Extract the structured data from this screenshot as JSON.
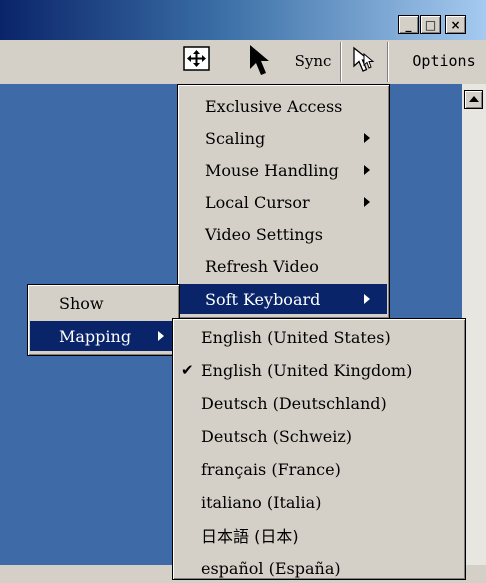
{
  "window": {
    "minimize_glyph": "_",
    "maximize_glyph": "□",
    "close_glyph": "×"
  },
  "toolbar": {
    "fit_icon": "fit-screen-icon",
    "pointer_icon": "pointer-icon",
    "sync_label": "Sync",
    "single_cursor_icon": "single-cursor-icon",
    "options_label": "Options"
  },
  "options_menu": {
    "items": [
      {
        "label": "Exclusive Access",
        "submenu": false
      },
      {
        "label": "Scaling",
        "submenu": true
      },
      {
        "label": "Mouse Handling",
        "submenu": true
      },
      {
        "label": "Local Cursor",
        "submenu": true
      },
      {
        "label": "Video Settings",
        "submenu": false
      },
      {
        "label": "Refresh Video",
        "submenu": false
      },
      {
        "label": "Soft Keyboard",
        "submenu": true,
        "selected": true
      }
    ]
  },
  "soft_keyboard_menu": {
    "items": [
      {
        "label": "Show",
        "submenu": false
      },
      {
        "label": "Mapping",
        "submenu": true,
        "selected": true
      }
    ]
  },
  "mapping_menu": {
    "checkmark": "✔",
    "items": [
      {
        "label": "English (United States)",
        "checked": false
      },
      {
        "label": "English (United Kingdom)",
        "checked": true
      },
      {
        "label": "Deutsch (Deutschland)",
        "checked": false
      },
      {
        "label": "Deutsch (Schweiz)",
        "checked": false
      },
      {
        "label": "français (France)",
        "checked": false
      },
      {
        "label": "italiano (Italia)",
        "checked": false
      },
      {
        "label": "日本語 (日本)",
        "checked": false
      },
      {
        "label": "español (España)",
        "checked": false
      }
    ]
  },
  "colors": {
    "menu_face": "#d4d0c8",
    "highlight": "#0a246a",
    "desktop": "#3f6aa8"
  }
}
